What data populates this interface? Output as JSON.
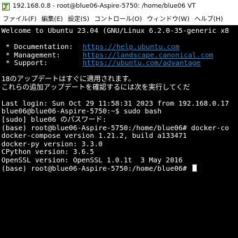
{
  "window": {
    "title": "192.168.0.8 - root@blue06-Aspire-5750: /home/blue06 VT"
  },
  "menu": [
    "ファイル(F)",
    "編集(E)",
    "設定(S)",
    "コントロール(O)",
    "ウィンドウ(W)",
    "ヘルプ(H)"
  ],
  "terminal": {
    "welcome": "Welcome to Ubuntu 23.04 (GNU/Linux 6.2.0-35-generic x8",
    "blank1": "",
    "links": [
      {
        "label": " * Documentation:",
        "url": "https://help.ubuntu.com"
      },
      {
        "label": " * Management:",
        "url": "https://landscape.canonical.com"
      },
      {
        "label": " * Support:",
        "url": "https://ubuntu.com/advantage"
      }
    ],
    "blank2": "",
    "updates_1": "18のアップデートはすぐに適用されます。",
    "updates_2": "これらの追加アップデートを確認するには次を実行してくだ",
    "blank3": "",
    "last_login": "Last login: Sun Oct 29 11:58:31 2023 from 192.168.0.17",
    "sudo_cmd": "blue06@blue06-Aspire-5750:~$ sudo bash",
    "sudo_prompt": "[sudo] blue06 のパスワード:",
    "compose_cmd": "(base) root@blue06-Aspire-5750:/home/blue06# docker-co",
    "compose_version": "docker-compose version 1.21.2, build a133471",
    "docker_py": "docker-py version: 3.3.0",
    "cpython": "CPython version: 3.6.5",
    "openssl": "OpenSSL version: OpenSSL 1.0.1t  3 May 2016",
    "final_prompt": "(base) root@blue06-Aspire-5750:/home/blue06# "
  },
  "colors": {
    "terminal_bg": "#000000",
    "terminal_fg": "#ffffff",
    "link": "#2f86d8"
  }
}
